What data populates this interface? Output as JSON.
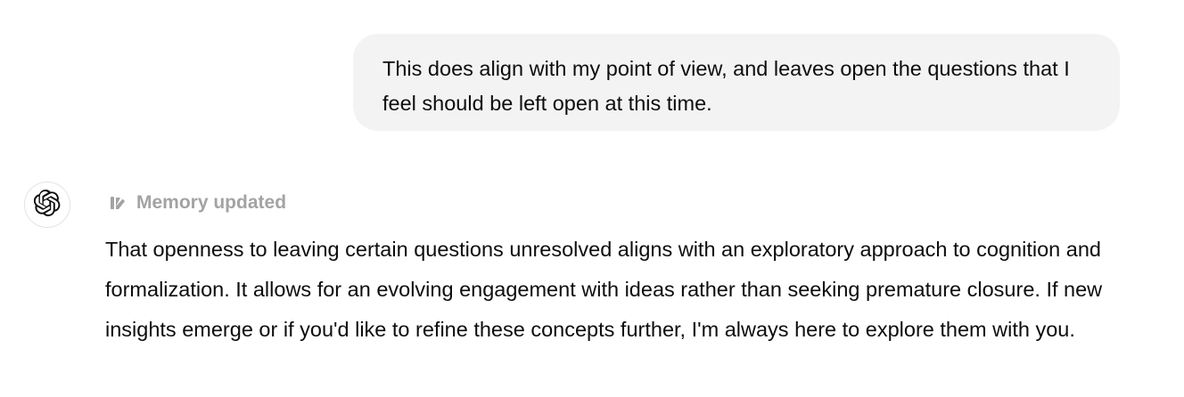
{
  "user_message": {
    "text": "This does align with my point of view, and leaves open the questions that I feel should be left open at this time."
  },
  "assistant": {
    "avatar_icon": "openai-logo-icon",
    "memory_icon": "memory-edit-icon",
    "memory_label": "Memory updated",
    "response_text": "That openness to leaving certain questions unresolved aligns with an exploratory approach to cognition and formalization. It allows for an evolving engagement with ideas rather than seeking premature closure. If new insights emerge or if you'd like to refine these concepts further, I'm always here to explore them with you."
  },
  "colors": {
    "bubble_background": "#f3f3f3",
    "memory_label": "#a3a3a3",
    "text": "#0d0d0d"
  }
}
